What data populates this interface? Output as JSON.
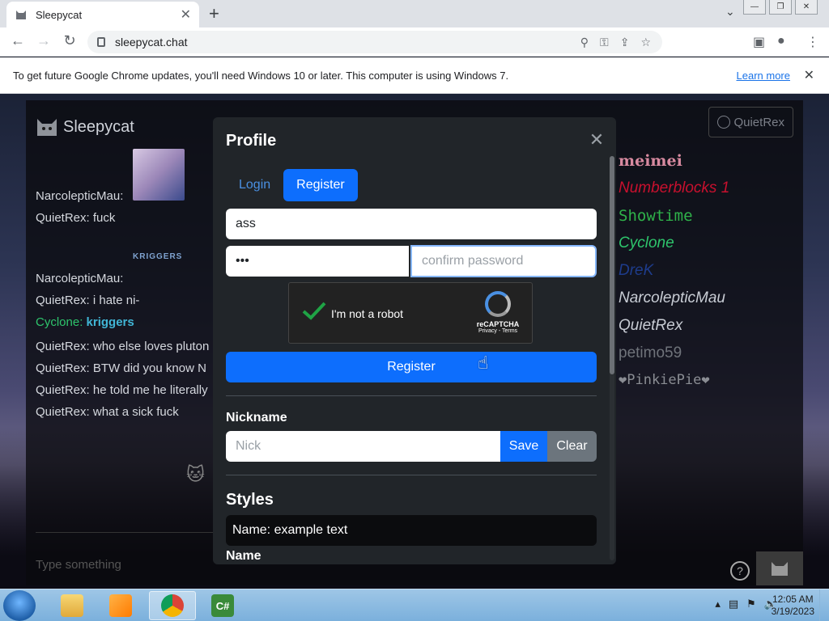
{
  "browser": {
    "tab_title": "Sleepycat",
    "url": "sleepycat.chat",
    "infobar_text": "To get future Google Chrome updates, you'll need Windows 10 or later. This computer is using Windows 7.",
    "infobar_link": "Learn more"
  },
  "app": {
    "brand": "Sleepycat",
    "user_button": "QuietRex",
    "composer_placeholder": "Type something"
  },
  "chat": [
    {
      "text": "NarcolepticMau:"
    },
    {
      "text": "QuietRex: fuck"
    },
    {
      "text": "NarcolepticMau:"
    },
    {
      "text": "QuietRex: i hate ni-"
    },
    {
      "name": "Cyclone:",
      "msg": "kriggers"
    },
    {
      "text": "QuietRex: who else loves pluton"
    },
    {
      "text": "QuietRex: BTW did you know N"
    },
    {
      "text": "QuietRex: he told me he literally"
    },
    {
      "text": "QuietRex: what a sick fuck"
    }
  ],
  "chat_image_text": "KRIGGERS",
  "users": [
    {
      "name": "meimei",
      "color": "#d88aa0"
    },
    {
      "name": "Numberblocks 1",
      "color": "#c8102e"
    },
    {
      "name": "Showtime",
      "color": "#2fb24a"
    },
    {
      "name": "Cyclone",
      "color": "#2ec46c"
    },
    {
      "name": "DreK",
      "color": "#1e3c8c"
    },
    {
      "name": "NarcolepticMau",
      "color": "#c8ccd4"
    },
    {
      "name": "QuietRex",
      "color": "#c8ccd4"
    },
    {
      "name": "petimo59",
      "color": "#6f737a"
    },
    {
      "name": "❤PinkiePie❤",
      "color": "#8a8d93"
    }
  ],
  "modal": {
    "title": "Profile",
    "tabs": {
      "login": "Login",
      "register": "Register"
    },
    "username_value": "ass",
    "password_value": "•••",
    "confirm_placeholder": "confirm password",
    "captcha_label": "I'm not a robot",
    "captcha_brand": "reCAPTCHA",
    "captcha_links": "Privacy - Terms",
    "register_button": "Register",
    "nickname_label": "Nickname",
    "nickname_placeholder": "Nick",
    "save_button": "Save",
    "clear_button": "Clear",
    "styles_label": "Styles",
    "preview_text": "Name:  example text",
    "name_label": "Name"
  },
  "taskbar": {
    "time": "12:05 AM",
    "date": "3/19/2023"
  }
}
